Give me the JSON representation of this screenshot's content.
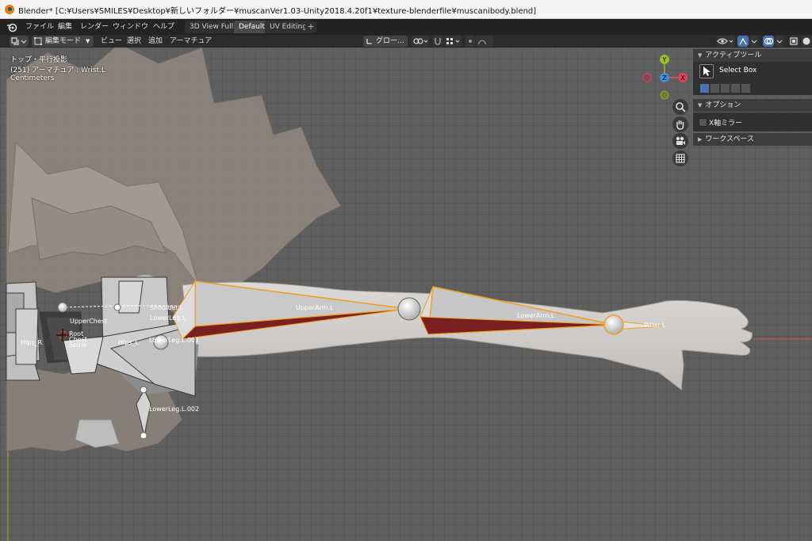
{
  "window": {
    "title": "Blender* [C:¥Users¥SMILES¥Desktop¥新しいフォルダー¥muscanVer1.03-Unity2018.4.20f1¥texture-blenderfile¥muscanibody.blend]"
  },
  "menubar": {
    "items": [
      "ファイル",
      "編集",
      "レンダー",
      "ウィンドウ",
      "ヘルプ"
    ],
    "workspace_tabs": [
      "3D View Full",
      "Default",
      "UV Editing"
    ],
    "active_tab": "Default",
    "add_tab": "+"
  },
  "header": {
    "mode_label": "編集モード",
    "menus": [
      "ビュー",
      "選択",
      "追加",
      "アーマチュア"
    ],
    "transform_orientation": "グロー…"
  },
  "viewport": {
    "view_name": "トップ・平行投影",
    "active_object": "(251) アーマチュア : Wrist.L",
    "units": "Centimeters",
    "axis_labels": {
      "x": "X",
      "y": "Y",
      "z": "Z"
    }
  },
  "bones": {
    "upper_arm": "UpperArm.L",
    "lower_arm": "LowerArm.L",
    "wrist": "Wrist.L",
    "shoulder": "Shoulder.L",
    "lower_leg": "LowerLeg.L",
    "lower_leg_001": "LowerLeg.L.001",
    "lower_leg_002": "LowerLeg.L.002",
    "upper_chest": "UpperChest",
    "hips_r": "Hips_R",
    "hips_l": "Hips_L",
    "root": "Root",
    "chest": "Chest",
    "spine": "Spine"
  },
  "sidebar": {
    "active_tool_header": "アクティブツール",
    "tool_name": "Select Box",
    "options_header": "オプション",
    "x_mirror_label": "X軸ミラー",
    "x_mirror_checked": false,
    "workspace_header": "ワークスペース"
  },
  "colors": {
    "active_bone": "#f0a020",
    "bone_fill": "#c4c4c4",
    "viewport_bg": "#5f5f5f",
    "accent": "#4772b3"
  }
}
